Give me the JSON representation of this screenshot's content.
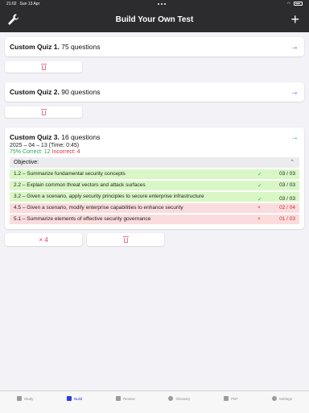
{
  "status": {
    "time": "21:02",
    "date": "Sun 13 Apr",
    "battery": ""
  },
  "nav": {
    "title": "Build Your Own Test",
    "left_icon": "wrench-icon",
    "right_icon": "plus-icon"
  },
  "quizzes": [
    {
      "name": "Custom Quiz 1.",
      "count": " 75 questions"
    },
    {
      "name": "Custom Quiz 2.",
      "count": " 90 questions"
    },
    {
      "name": "Custom Quiz 3.",
      "count": " 16 questions"
    }
  ],
  "quiz3": {
    "date_time": "2025 – 04 – 13 (Time: 0:45)",
    "percent": "75%",
    "correct": "Correct: 12",
    "incorrect": "Incorrect: 4",
    "objective_label": "Objective:",
    "objectives": [
      {
        "text": "1.2 – Summarize fundamental security concepts",
        "mark": "✓",
        "score": "03 / 03",
        "status": "ok"
      },
      {
        "text": "2.2 – Explain common threat vectors and attack surfaces",
        "mark": "✓",
        "score": "03 / 03",
        "status": "ok"
      },
      {
        "text": "3.2 – Given a scenario, apply security principles to secure enterprise infrastructure",
        "mark": "✓",
        "score": "03 / 03",
        "status": "ok"
      },
      {
        "text": "4.5 – Given a scenario, modify enterprise capabilities to enhance security",
        "mark": "×",
        "score": "02 / 04",
        "status": "bad"
      },
      {
        "text": "5.1 – Summarize elements of effective security governance",
        "mark": "×",
        "score": "01 / 03",
        "status": "bad"
      }
    ],
    "wrong_button": "× 4"
  },
  "tabs": [
    {
      "label": "Study",
      "icon": "book-icon"
    },
    {
      "label": "Build",
      "icon": "wrench-icon",
      "active": true
    },
    {
      "label": "Review",
      "icon": "stack-icon"
    },
    {
      "label": "Glossary",
      "icon": "search-icon"
    },
    {
      "label": "PDF",
      "icon": "pdf-icon"
    },
    {
      "label": "Settings",
      "icon": "gear-icon"
    }
  ],
  "colors": {
    "accent": "#2a3fdf",
    "correct": "#2fa65a",
    "incorrect": "#d9303c",
    "delete": "#ec6f8a",
    "navbar": "#2c2c2e"
  }
}
